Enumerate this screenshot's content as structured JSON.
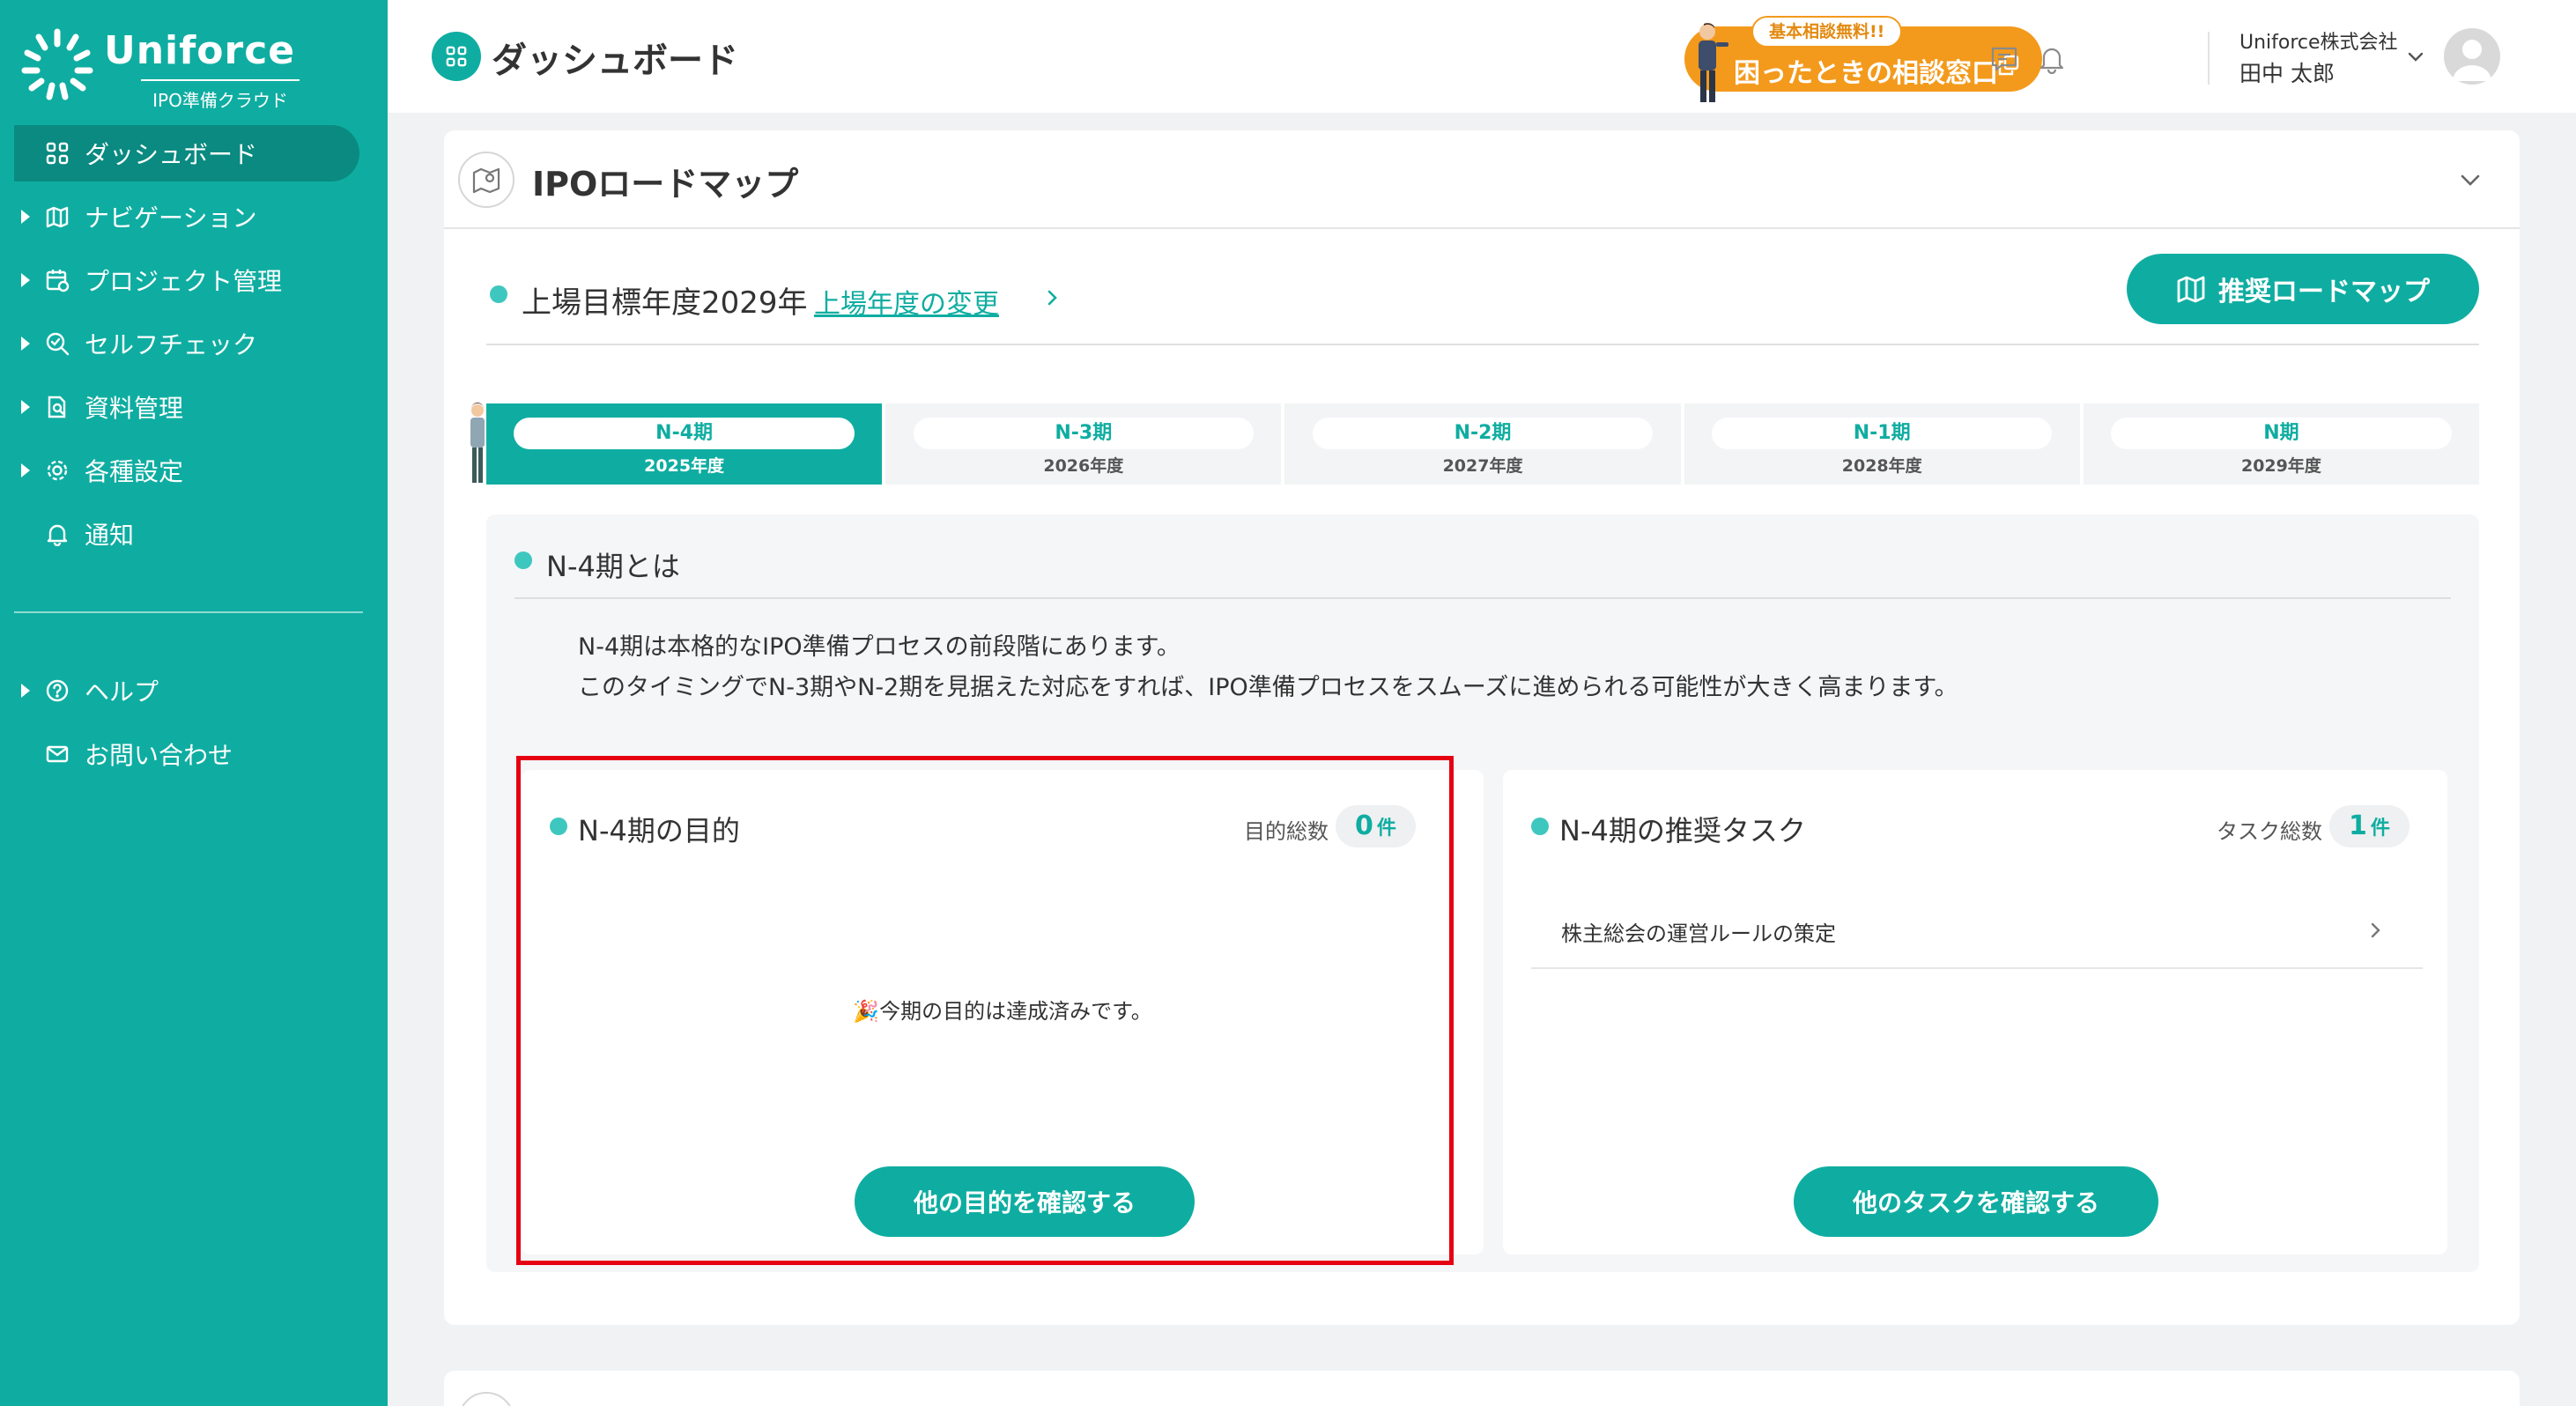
{
  "app": {
    "logo_text": "Uniforce",
    "logo_sub": "IPO準備クラウド"
  },
  "sidebar": {
    "items": [
      {
        "label": "ダッシュボード",
        "icon": "grid-icon",
        "active": true,
        "caret": false
      },
      {
        "label": "ナビゲーション",
        "icon": "map-icon",
        "active": false,
        "caret": true
      },
      {
        "label": "プロジェクト管理",
        "icon": "calendar-check-icon",
        "active": false,
        "caret": true
      },
      {
        "label": "セルフチェック",
        "icon": "search-check-icon",
        "active": false,
        "caret": true
      },
      {
        "label": "資料管理",
        "icon": "document-search-icon",
        "active": false,
        "caret": true
      },
      {
        "label": "各種設定",
        "icon": "gear-icon",
        "active": false,
        "caret": true
      },
      {
        "label": "通知",
        "icon": "bell-icon",
        "active": false,
        "caret": false
      }
    ],
    "bottom_items": [
      {
        "label": "ヘルプ",
        "icon": "help-circle-icon",
        "caret": true
      },
      {
        "label": "お問い合わせ",
        "icon": "mail-icon",
        "caret": false
      }
    ]
  },
  "header": {
    "page_title": "ダッシュボード",
    "consult_badge": "基本相談無料!!",
    "consult_label": "困ったときの相談窓口",
    "company": "Uniforce株式会社",
    "user": "田中 太郎"
  },
  "roadmap": {
    "title": "IPOロードマップ",
    "target_label": "上場目標年度2029年",
    "change_link": "上場年度の変更",
    "recommend_button": "推奨ロードマップ",
    "tabs": [
      {
        "period": "N-4期",
        "year": "2025年度",
        "active": true
      },
      {
        "period": "N-3期",
        "year": "2026年度",
        "active": false
      },
      {
        "period": "N-2期",
        "year": "2027年度",
        "active": false
      },
      {
        "period": "N-1期",
        "year": "2028年度",
        "active": false
      },
      {
        "period": "N期",
        "year": "2029年度",
        "active": false
      }
    ],
    "panel": {
      "title": "N-4期とは",
      "desc_line1": "N-4期は本格的なIPO準備プロセスの前段階にあります。",
      "desc_line2": "このタイミングでN-3期やN-2期を見据えた対応をすれば、IPO準備プロセスをスムーズに進められる可能性が大きく高まります。"
    },
    "goals": {
      "title": "N-4期の目的",
      "count_label": "目的総数",
      "count": "0",
      "unit": "件",
      "empty_message": "🎉今期の目的は達成済みです。",
      "button": "他の目的を確認する"
    },
    "tasks": {
      "title": "N-4期の推奨タスク",
      "count_label": "タスク総数",
      "count": "1",
      "unit": "件",
      "items": [
        "株主総会の運営ルールの策定"
      ],
      "button": "他のタスクを確認する"
    }
  },
  "colors": {
    "brand": "#0fada1",
    "accent_orange": "#f39a1c",
    "highlight_red": "#e50012"
  }
}
